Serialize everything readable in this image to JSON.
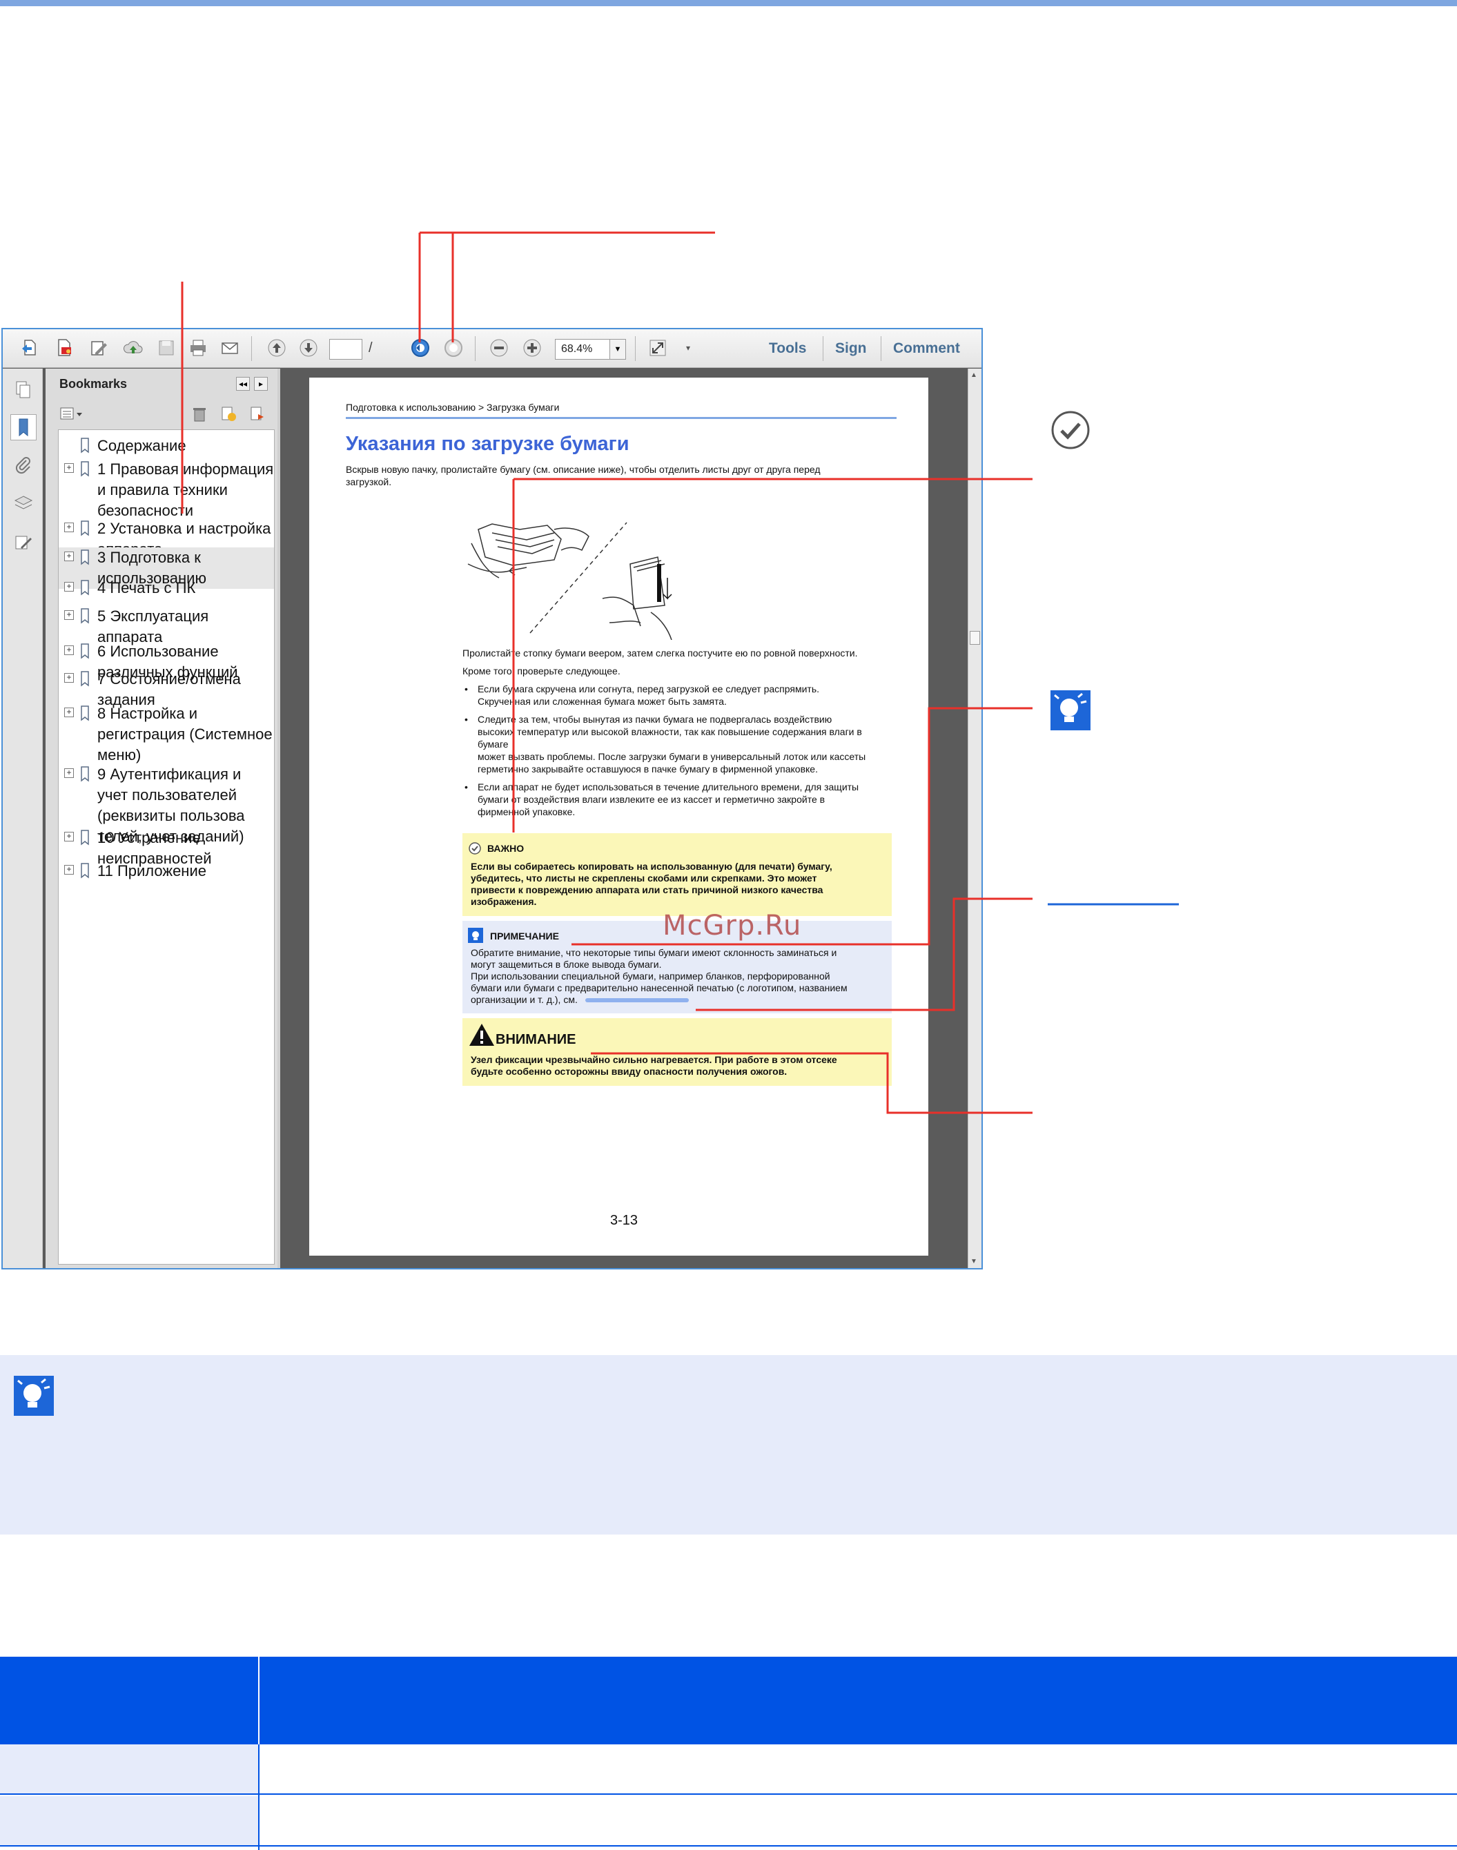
{
  "toolbar": {
    "page_input": "",
    "page_separator": "/",
    "page_total": "",
    "zoom_value": "68.4%",
    "tools_label": "Tools",
    "sign_label": "Sign",
    "comment_label": "Comment"
  },
  "bookmarks": {
    "header": "Bookmarks",
    "items": [
      {
        "label": "Содержание",
        "expandable": false
      },
      {
        "label": "1 Правовая информация и правила техники безопасности",
        "expandable": true
      },
      {
        "label": "2 Установка и настройка аппарата",
        "expandable": true
      },
      {
        "label": "3 Подготовка к использованию",
        "expandable": true,
        "selected": true
      },
      {
        "label": "4 Печать с ПК",
        "expandable": true
      },
      {
        "label": "5 Эксплуатация аппарата",
        "expandable": true
      },
      {
        "label": "6 Использование различных функций",
        "expandable": true
      },
      {
        "label": "7 Состояние/отмена задания",
        "expandable": true
      },
      {
        "label": "8 Настройка и регистрация (Системное меню)",
        "expandable": true
      },
      {
        "label": "9 Аутентификация и учет пользователей (реквизиты пользова телей, учет заданий)",
        "expandable": true
      },
      {
        "label": "10 Устранение неисправностей",
        "expandable": true
      },
      {
        "label": "11 Приложение",
        "expandable": true
      }
    ]
  },
  "document": {
    "breadcrumb": "Подготовка к использованию > Загрузка бумаги",
    "title": "Указания по загрузке бумаги",
    "intro": [
      "Вскрыв новую пачку, пролистайте бумагу (см. описание ниже), чтобы отделить листы друг от друга перед",
      "загрузкой."
    ],
    "fan_text": "Пролистайте стопку бумаги веером, затем слегка постучите ею по ровной поверхности.",
    "check_text": "Кроме того, проверьте следующее.",
    "bullets": [
      [
        "Если бумага скручена или согнута, перед загрузкой ее следует распрямить.",
        "Скрученная или сложенная бумага может быть замята."
      ],
      [
        "Следите за тем, чтобы вынутая из пачки бумага не подвергалась воздействию",
        "высоких температур или высокой влажности, так как повышение содержания влаги в",
        "бумаге",
        "может вызвать проблемы. После загрузки бумаги в универсальный лоток или кассеты",
        "герметично закрывайте оставшуюся в пачке бумагу в фирменной упаковке."
      ],
      [
        "Если аппарат не будет использоваться в течение длительного времени, для защиты",
        "бумаги от воздействия влаги извлеките ее из кассет и герметично закройте в",
        "фирменной упаковке."
      ]
    ],
    "important": {
      "title": "ВАЖНО",
      "lines": [
        "Если вы собираетесь копировать на использованную (для печати) бумагу,",
        "убедитесь, что листы не скреплены скобами или скрепками. Это может",
        "привести к повреждению аппарата или стать причиной низкого качества",
        "изображения."
      ]
    },
    "note": {
      "title": "ПРИМЕЧАНИЕ",
      "lines": [
        "Обратите внимание, что некоторые типы бумаги имеют склонность заминаться и",
        "могут защемиться в блоке вывода бумаги.",
        "При использовании специальной бумаги, например бланков, перфорированной",
        "бумаги или бумаги с предварительно нанесенной печатью (с логотипом, названием",
        "организации и т. д.), см."
      ]
    },
    "warning": {
      "title": "ВНИМАНИЕ",
      "lines": [
        "Узел фиксации чрезвычайно сильно нагревается. При работе в этом отсеке",
        "будьте особенно осторожны ввиду опасности получения ожогов."
      ]
    },
    "page_number": "3-13"
  },
  "watermark": "McGrp.Ru",
  "colors": {
    "accent_blue": "#0053e4",
    "callout_red": "#e8302a",
    "title_blue": "#3c64d6",
    "important_bg": "#fbf7b8",
    "note_bg": "#e6ebf8",
    "tip_bg": "#e6ebfa"
  },
  "icons": [
    "open-icon",
    "pdf-icon",
    "edit-icon",
    "upload-icon",
    "save-icon",
    "print-icon",
    "email-icon",
    "prev-page-icon",
    "next-page-icon",
    "back-view-icon",
    "forward-view-icon",
    "zoom-out-icon",
    "zoom-in-icon",
    "fullscreen-icon",
    "check-circle-icon",
    "lightbulb-note-icon",
    "warning-triangle-icon"
  ]
}
